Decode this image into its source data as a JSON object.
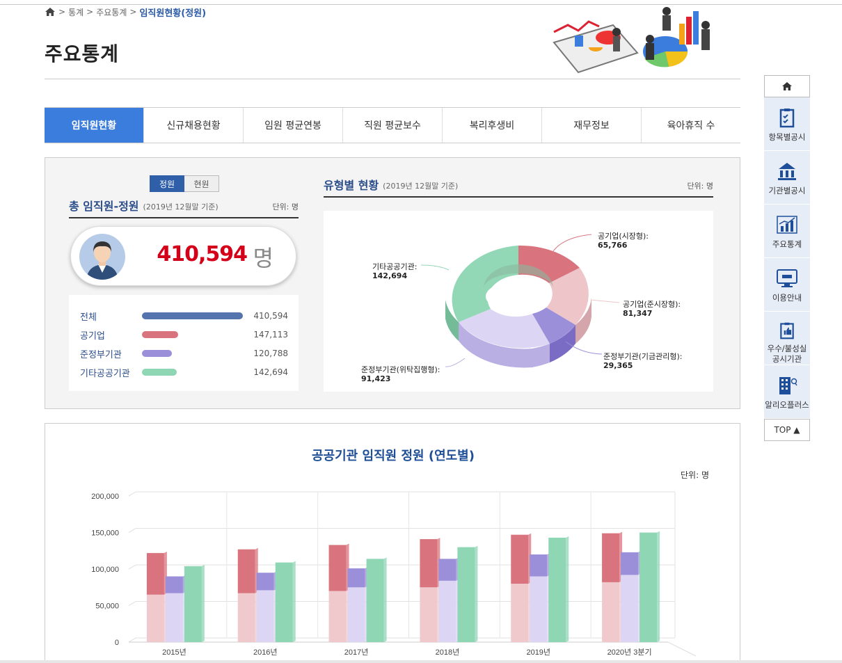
{
  "breadcrumb": {
    "items": [
      "통계",
      "주요통계"
    ],
    "current": "임직원현황(정원)",
    "sep": ">"
  },
  "page": {
    "title": "주요통계"
  },
  "tabs": [
    "임직원현황",
    "신규채용현황",
    "임원 평균연봉",
    "직원 평균보수",
    "복리후생비",
    "재무정보",
    "육아휴직 수"
  ],
  "active_tab": 0,
  "toggle": {
    "on": "정원",
    "off": "현원"
  },
  "total": {
    "heading": "총 임직원-정원",
    "sub": "(2019년 12월말 기준)",
    "unit_label": "단위: 명",
    "value": "410,594",
    "value_unit": "명"
  },
  "legend": [
    {
      "name": "전체",
      "value": "410,594",
      "color": "#5573ad",
      "fraction": 1.0
    },
    {
      "name": "공기업",
      "value": "147,113",
      "color": "#d9737e",
      "fraction": 0.358
    },
    {
      "name": "준정부기관",
      "value": "120,788",
      "color": "#9b8fd9",
      "fraction": 0.294
    },
    {
      "name": "기타공공기관",
      "value": "142,694",
      "color": "#8fd6b5",
      "fraction": 0.348
    }
  ],
  "donut": {
    "heading": "유형별 현황",
    "sub": "(2019년 12월말 기준)",
    "unit_label": "단위: 명",
    "labels": [
      {
        "name": "공기업(시장형):",
        "value": "65,766"
      },
      {
        "name": "공기업(준시장형):",
        "value": "81,347"
      },
      {
        "name": "준정부기관(기금관리형):",
        "value": "29,365"
      },
      {
        "name": "준정부기관(위탁집행형):",
        "value": "91,423"
      },
      {
        "name": "기타공공기관:",
        "value": "142,694"
      }
    ]
  },
  "chart_section": {
    "title": "공공기관 임직원 정원 (연도별)",
    "unit_label": "단위: 명"
  },
  "chart_data": {
    "type": "bar",
    "title": "공공기관 임직원 정원 (연도별)",
    "categories": [
      "2015년",
      "2016년",
      "2017년",
      "2018년",
      "2019년",
      "2020년 3분기"
    ],
    "ylim": [
      0,
      200000
    ],
    "yticks": [
      "0",
      "50,000",
      "100,000",
      "150,000",
      "200,000"
    ],
    "grid": true,
    "stacked_groups": true,
    "series": [
      {
        "group": "공기업",
        "part": "lower",
        "color": "#f0c9cd",
        "values": [
          65000,
          67000,
          70000,
          75000,
          80000,
          82000
        ]
      },
      {
        "group": "공기업",
        "part": "upper",
        "color": "#d9737e",
        "values": [
          57000,
          60000,
          63000,
          66000,
          67000,
          67000
        ]
      },
      {
        "group": "준정부기관",
        "part": "lower",
        "color": "#dcd5f3",
        "values": [
          67000,
          71000,
          75000,
          84000,
          90000,
          92000
        ]
      },
      {
        "group": "준정부기관",
        "part": "upper",
        "color": "#9b8fd9",
        "values": [
          23000,
          24000,
          26000,
          30000,
          30000,
          31000
        ]
      },
      {
        "group": "기타공공기관",
        "part": "total",
        "color": "#8fd6b5",
        "values": [
          104000,
          109000,
          114000,
          130000,
          143000,
          150000
        ]
      }
    ]
  },
  "quicknav": [
    {
      "label": "항목별공시",
      "icon": "clipboard-check-icon"
    },
    {
      "label": "기관별공시",
      "icon": "building-icon"
    },
    {
      "label": "주요통계",
      "icon": "chart-icon"
    },
    {
      "label": "이용안내",
      "icon": "monitor-icon"
    },
    {
      "label": "우수/불성실\n공시기관",
      "icon": "thumbs-up-icon"
    },
    {
      "label": "알리오플러스",
      "icon": "office-icon"
    }
  ],
  "top_button": "TOP ▲"
}
